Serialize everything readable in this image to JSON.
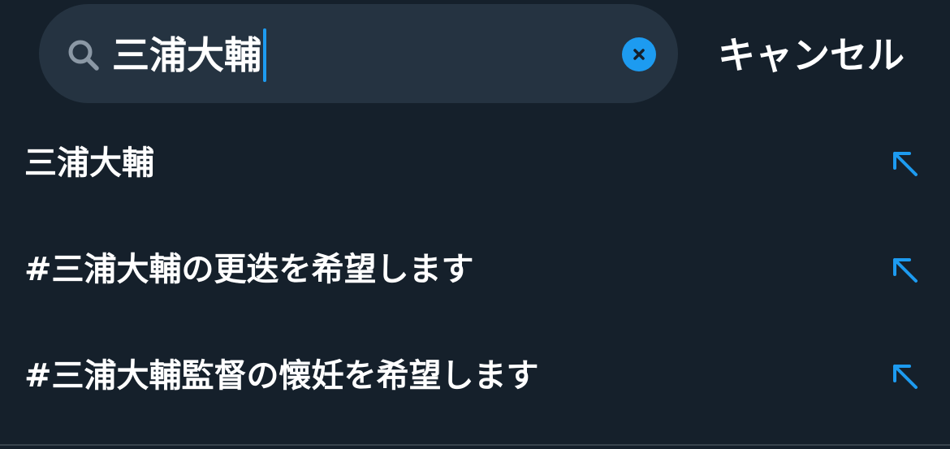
{
  "search": {
    "query": "三浦大輔",
    "clear_icon": "close-circle-icon",
    "search_icon": "search-icon"
  },
  "cancel_label": "キャンセル",
  "suggestions": [
    {
      "text": "三浦大輔",
      "icon": "arrow-up-left-icon"
    },
    {
      "text": "#三浦大輔の更迭を希望します",
      "icon": "arrow-up-left-icon"
    },
    {
      "text": "#三浦大輔監督の懐妊を希望します",
      "icon": "arrow-up-left-icon"
    }
  ],
  "colors": {
    "background": "#15202b",
    "search_field": "#253341",
    "accent": "#1d9bf0",
    "text": "#ffffff",
    "icon_muted": "#8b98a5"
  }
}
